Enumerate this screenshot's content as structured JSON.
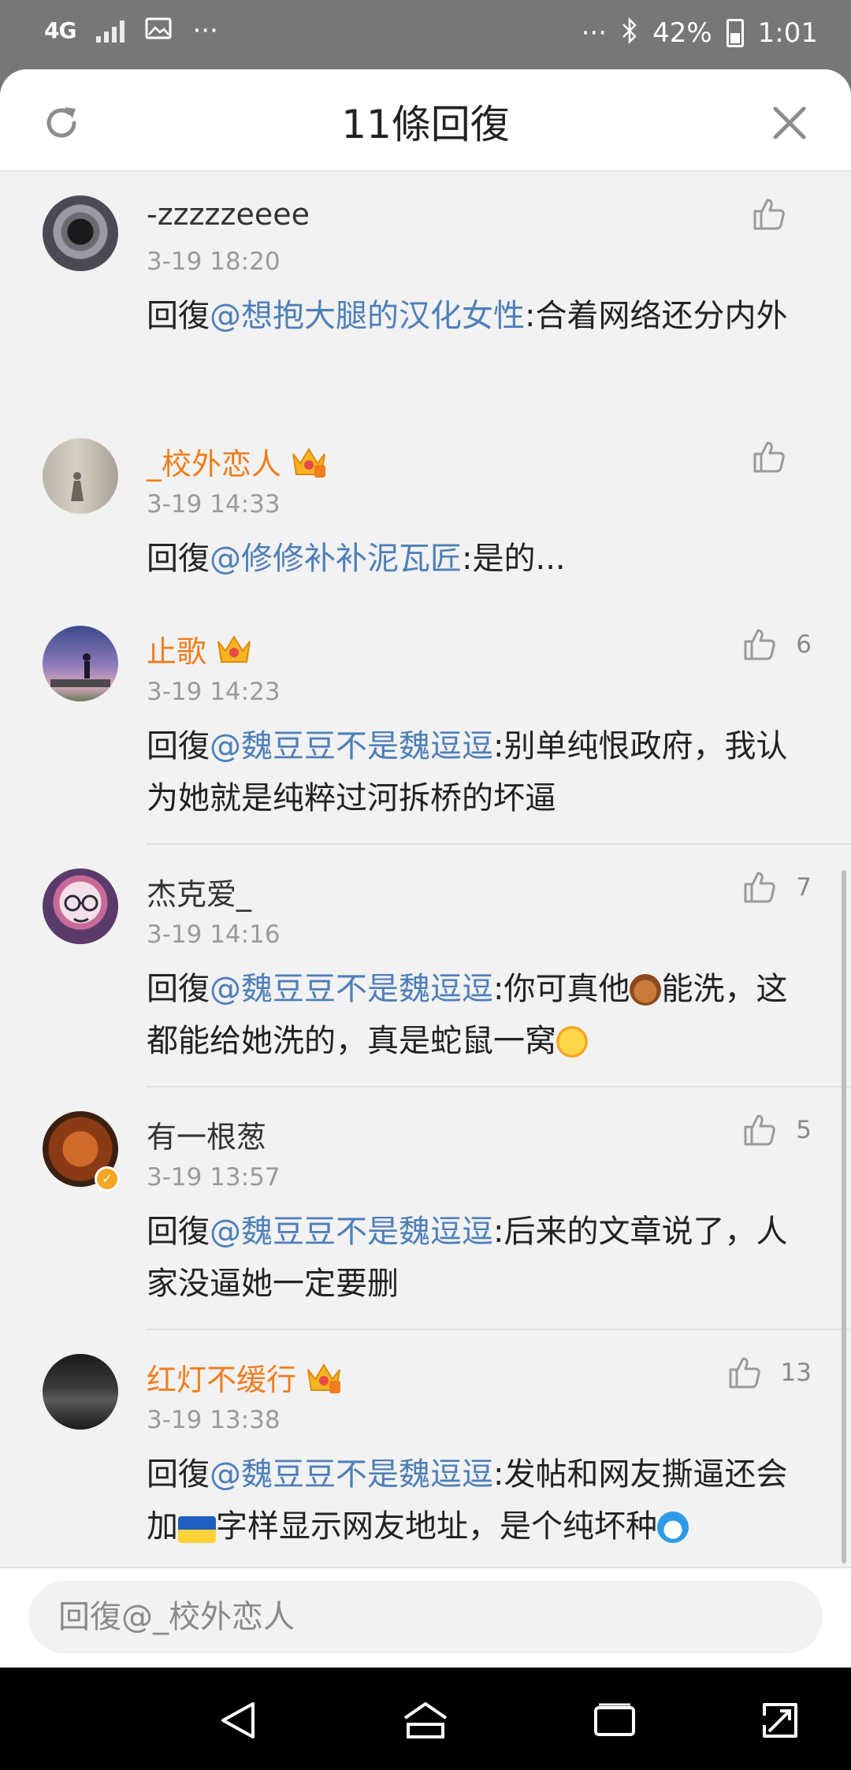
{
  "status_bar": {
    "network_type": "4G",
    "dots_left": "···",
    "dots_right": "···",
    "battery_percent": "42%",
    "time": "1:01",
    "icons": [
      "signal-icon",
      "image-icon",
      "bluetooth-icon",
      "battery-icon"
    ]
  },
  "sheet": {
    "title": "11條回復",
    "refresh_icon": "refresh-icon",
    "close_icon": "close-icon"
  },
  "comments": [
    {
      "username": "-zzzzzeeee",
      "vip": false,
      "timestamp": "3-19 18:20",
      "reply_prefix": "回復",
      "mention": "@想抱大腿的汉化女性",
      "text": ":合着网络还分内外",
      "likes": ""
    },
    {
      "username": "_校外恋人",
      "vip": true,
      "timestamp": "3-19 14:33",
      "reply_prefix": "回復",
      "mention": "@修修补补泥瓦匠",
      "text": ":是的...",
      "likes": ""
    },
    {
      "username": "止歌",
      "vip": true,
      "timestamp": "3-19 14:23",
      "reply_prefix": "回復",
      "mention": "@魏豆豆不是魏逗逗",
      "text": ":别单纯恨政府，我认为她就是纯粹过河拆桥的坏逼",
      "likes": "6"
    },
    {
      "username": "杰克爱_",
      "vip": false,
      "timestamp": "3-19 14:16",
      "reply_prefix": "回復",
      "mention": "@魏豆豆不是魏逗逗",
      "text_a": ":你可真他",
      "text_b": "能洗，这都能给她洗的，真是蛇鼠一窝",
      "emoji_a": "horse-emoji",
      "emoji_b": "face-emoji",
      "likes": "7"
    },
    {
      "username": "有一根葱",
      "vip": false,
      "verified": true,
      "timestamp": "3-19 13:57",
      "reply_prefix": "回復",
      "mention": "@魏豆豆不是魏逗逗",
      "text": ":后来的文章说了，人家没逼她一定要删",
      "likes": "5"
    },
    {
      "username": "红灯不缓行",
      "vip": true,
      "timestamp": "3-19 13:38",
      "reply_prefix": "回復",
      "mention": "@魏豆豆不是魏逗逗",
      "text_a": ":发帖和网友撕逼还会加",
      "text_b": "字样显示网友地址，是个纯坏种",
      "emoji_a": "ukraine-flag-emoji",
      "emoji_b": "doraemon-emoji",
      "likes": "13"
    }
  ],
  "reply_input": {
    "placeholder": "回復@_校外恋人"
  },
  "nav_bar": {
    "icons": [
      "back-icon",
      "home-icon",
      "recents-icon",
      "expand-icon"
    ]
  },
  "colors": {
    "vip_name": "#f07d1e",
    "mention": "#4e7fb8",
    "timestamp": "#9a9a9a",
    "status_bar_bg": "#777777",
    "sheet_bg": "#f2f2f2"
  }
}
